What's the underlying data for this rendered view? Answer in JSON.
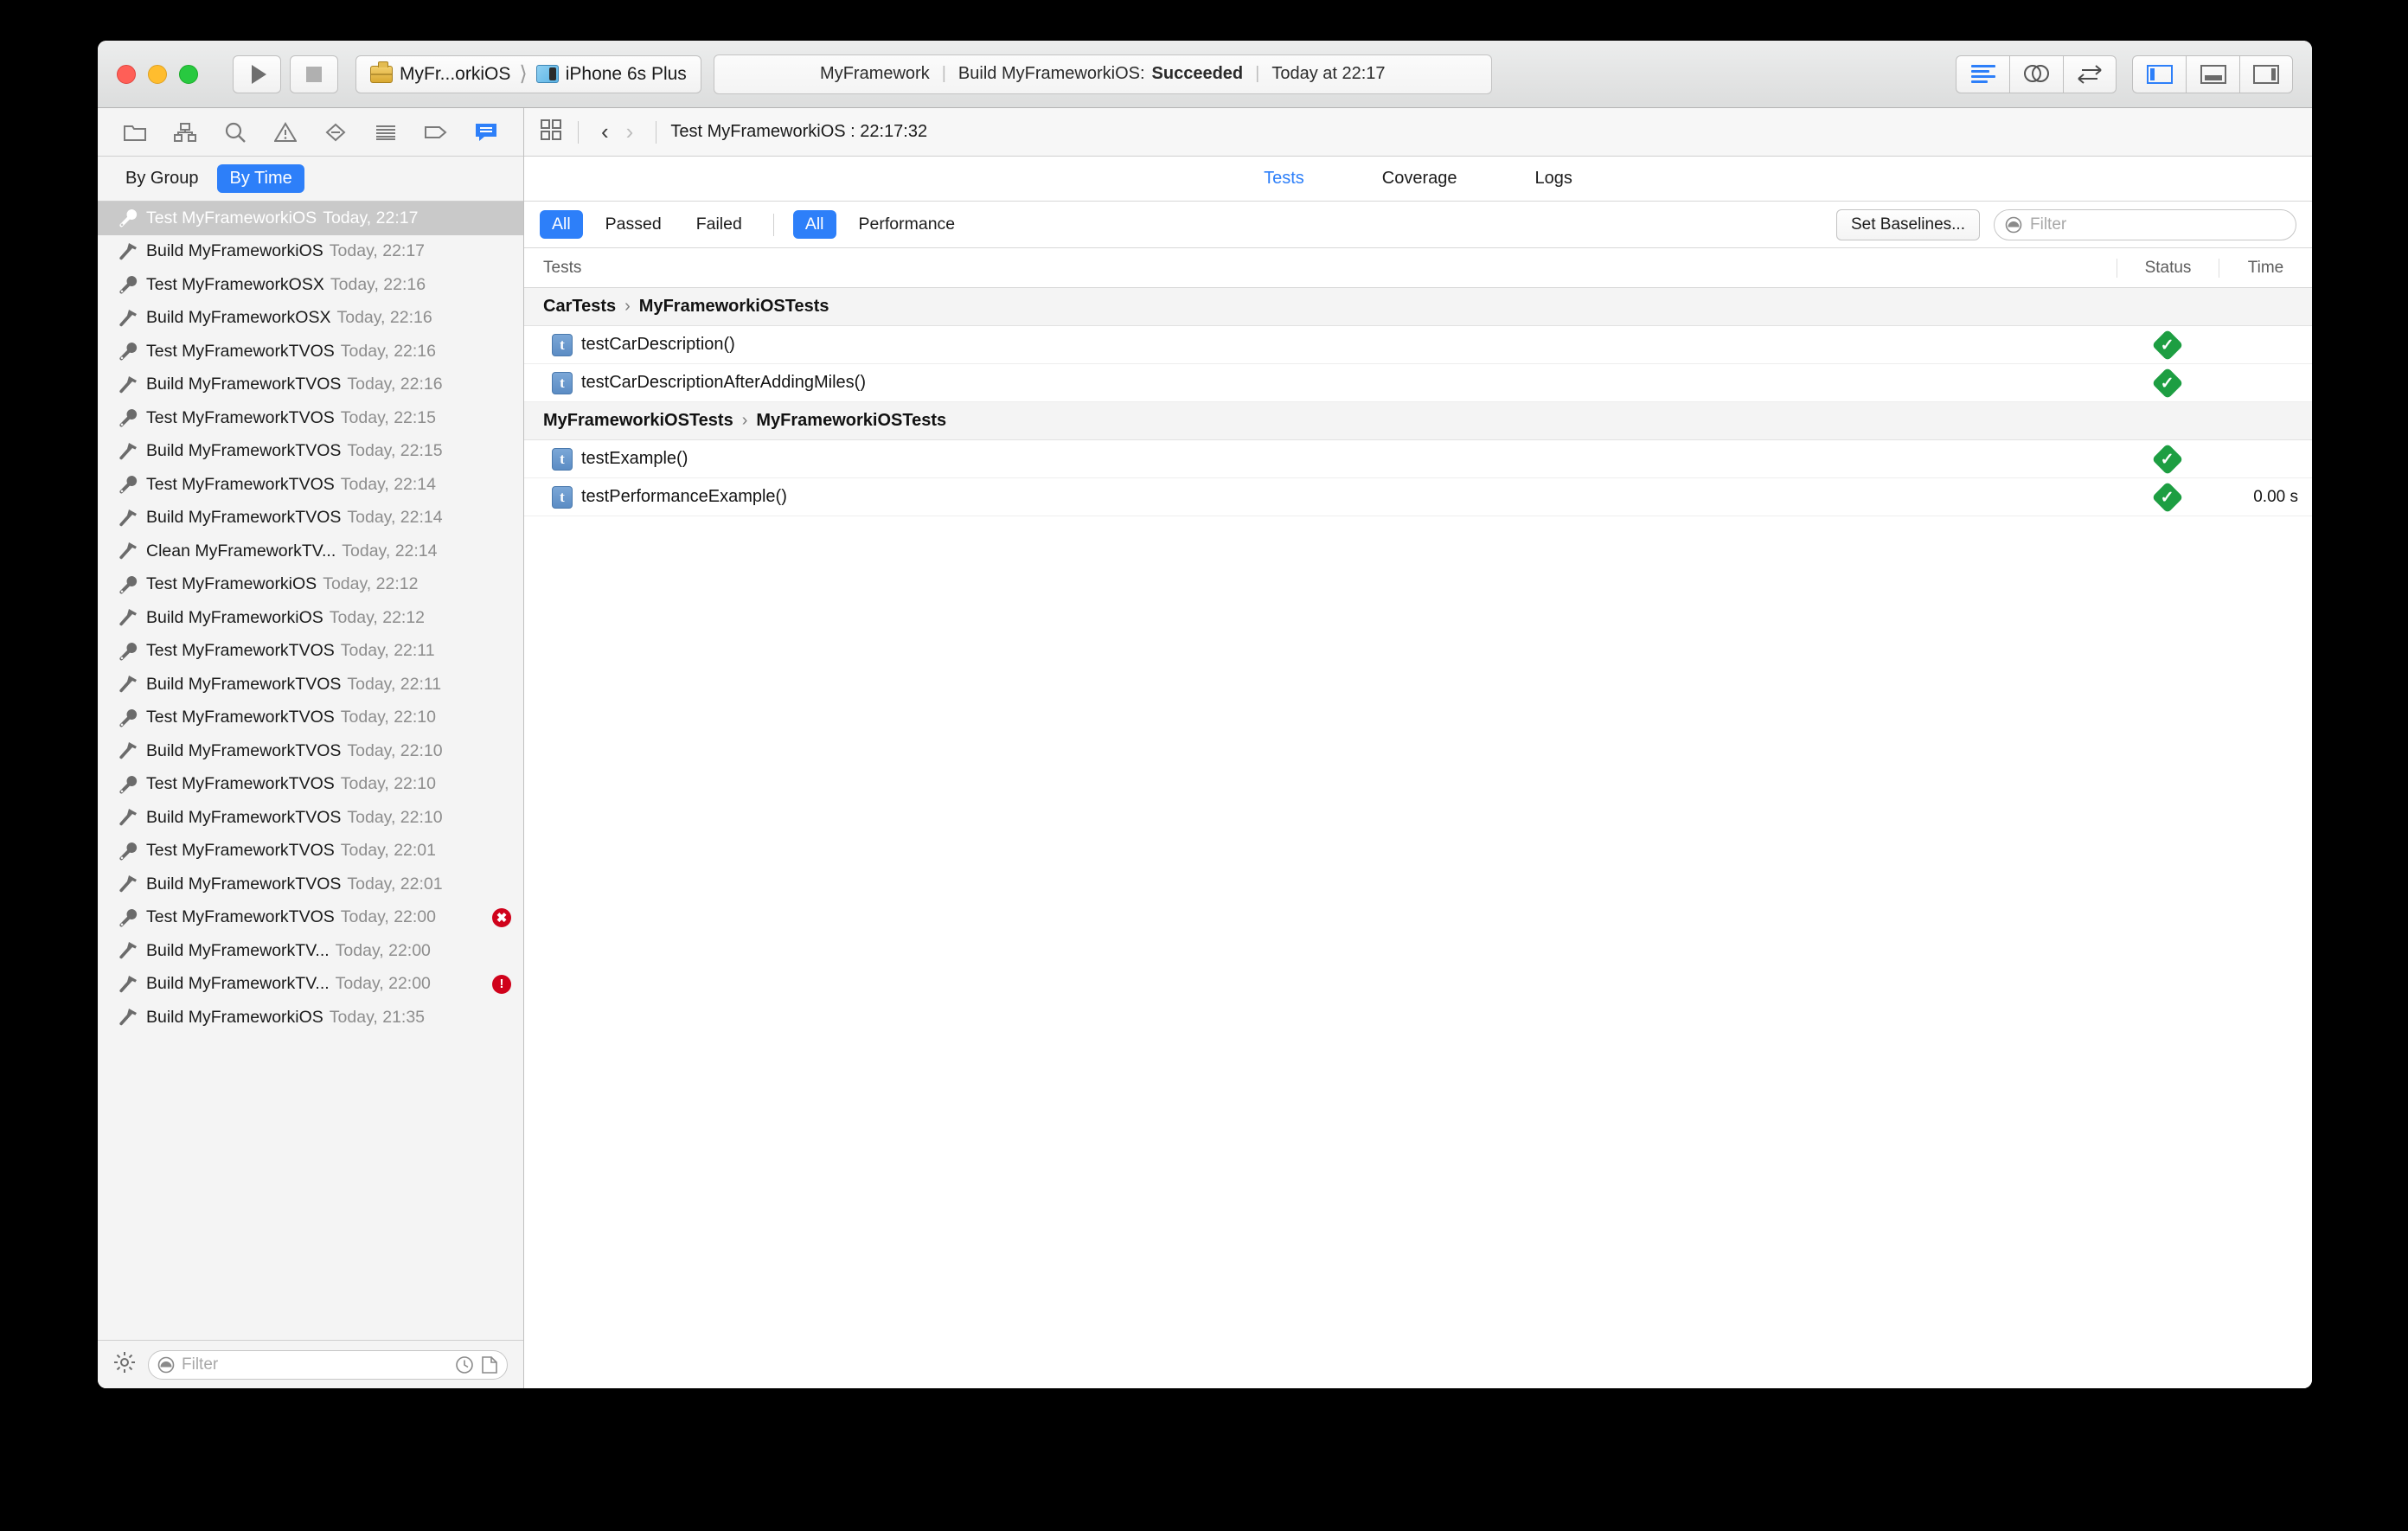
{
  "toolbar": {
    "run_label": "Run",
    "stop_label": "Stop",
    "scheme": "MyFr...orkiOS",
    "destination": "iPhone 6s Plus",
    "status": {
      "project": "MyFramework",
      "action": "Build MyFrameworkiOS:",
      "result": "Succeeded",
      "time": "Today at 22:17"
    },
    "editor_buttons": [
      "standard-editor",
      "assistant-editor",
      "version-editor"
    ],
    "view_buttons": [
      "navigator-toggle",
      "debug-area-toggle",
      "utilities-toggle"
    ]
  },
  "navigator": {
    "icons": [
      "folder-icon",
      "hierarchy-icon",
      "search-icon",
      "warning-icon",
      "breakpoint-icon",
      "report-list-icon",
      "tag-icon",
      "report-icon"
    ],
    "scope": {
      "by_group": "By Group",
      "by_time": "By Time",
      "selected": "By Time"
    },
    "rows": [
      {
        "icon": "wrench-icon",
        "label": "Test MyFrameworkiOS",
        "time": "Today, 22:17",
        "selected": true,
        "badge": ""
      },
      {
        "icon": "hammer-icon",
        "label": "Build MyFrameworkiOS",
        "time": "Today, 22:17",
        "selected": false,
        "badge": ""
      },
      {
        "icon": "wrench-icon",
        "label": "Test MyFrameworkOSX",
        "time": "Today, 22:16",
        "selected": false,
        "badge": ""
      },
      {
        "icon": "hammer-icon",
        "label": "Build MyFrameworkOSX",
        "time": "Today, 22:16",
        "selected": false,
        "badge": ""
      },
      {
        "icon": "wrench-icon",
        "label": "Test MyFrameworkTVOS",
        "time": "Today, 22:16",
        "selected": false,
        "badge": ""
      },
      {
        "icon": "hammer-icon",
        "label": "Build MyFrameworkTVOS",
        "time": "Today, 22:16",
        "selected": false,
        "badge": ""
      },
      {
        "icon": "wrench-icon",
        "label": "Test MyFrameworkTVOS",
        "time": "Today, 22:15",
        "selected": false,
        "badge": ""
      },
      {
        "icon": "hammer-icon",
        "label": "Build MyFrameworkTVOS",
        "time": "Today, 22:15",
        "selected": false,
        "badge": ""
      },
      {
        "icon": "wrench-icon",
        "label": "Test MyFrameworkTVOS",
        "time": "Today, 22:14",
        "selected": false,
        "badge": ""
      },
      {
        "icon": "hammer-icon",
        "label": "Build MyFrameworkTVOS",
        "time": "Today, 22:14",
        "selected": false,
        "badge": ""
      },
      {
        "icon": "hammer-icon",
        "label": "Clean MyFrameworkTV...",
        "time": "Today, 22:14",
        "selected": false,
        "badge": ""
      },
      {
        "icon": "wrench-icon",
        "label": "Test MyFrameworkiOS",
        "time": "Today, 22:12",
        "selected": false,
        "badge": ""
      },
      {
        "icon": "hammer-icon",
        "label": "Build MyFrameworkiOS",
        "time": "Today, 22:12",
        "selected": false,
        "badge": ""
      },
      {
        "icon": "wrench-icon",
        "label": "Test MyFrameworkTVOS",
        "time": "Today, 22:11",
        "selected": false,
        "badge": ""
      },
      {
        "icon": "hammer-icon",
        "label": "Build MyFrameworkTVOS",
        "time": "Today, 22:11",
        "selected": false,
        "badge": ""
      },
      {
        "icon": "wrench-icon",
        "label": "Test MyFrameworkTVOS",
        "time": "Today, 22:10",
        "selected": false,
        "badge": ""
      },
      {
        "icon": "hammer-icon",
        "label": "Build MyFrameworkTVOS",
        "time": "Today, 22:10",
        "selected": false,
        "badge": ""
      },
      {
        "icon": "wrench-icon",
        "label": "Test MyFrameworkTVOS",
        "time": "Today, 22:10",
        "selected": false,
        "badge": ""
      },
      {
        "icon": "hammer-icon",
        "label": "Build MyFrameworkTVOS",
        "time": "Today, 22:10",
        "selected": false,
        "badge": ""
      },
      {
        "icon": "wrench-icon",
        "label": "Test MyFrameworkTVOS",
        "time": "Today, 22:01",
        "selected": false,
        "badge": ""
      },
      {
        "icon": "hammer-icon",
        "label": "Build MyFrameworkTVOS",
        "time": "Today, 22:01",
        "selected": false,
        "badge": ""
      },
      {
        "icon": "wrench-icon",
        "label": "Test MyFrameworkTVOS",
        "time": "Today, 22:00",
        "selected": false,
        "badge": "error"
      },
      {
        "icon": "hammer-icon",
        "label": "Build MyFrameworkTV...",
        "time": "Today, 22:00",
        "selected": false,
        "badge": ""
      },
      {
        "icon": "hammer-icon",
        "label": "Build MyFrameworkTV...",
        "time": "Today, 22:00",
        "selected": false,
        "badge": "warning"
      },
      {
        "icon": "hammer-icon",
        "label": "Build MyFrameworkiOS",
        "time": "Today, 21:35",
        "selected": false,
        "badge": ""
      }
    ],
    "filter_placeholder": "Filter",
    "filter_value": ""
  },
  "editor": {
    "jumpbar": {
      "title": "Test MyFrameworkiOS : 22:17:32"
    },
    "tabs": [
      {
        "label": "Tests",
        "active": true
      },
      {
        "label": "Coverage",
        "active": false
      },
      {
        "label": "Logs",
        "active": false
      }
    ],
    "filters": {
      "result_group": [
        {
          "label": "All",
          "active": true
        },
        {
          "label": "Passed",
          "active": false
        },
        {
          "label": "Failed",
          "active": false
        }
      ],
      "kind_group": [
        {
          "label": "All",
          "active": true
        },
        {
          "label": "Performance",
          "active": false
        }
      ],
      "set_baselines": "Set Baselines...",
      "search_placeholder": "Filter",
      "search_value": ""
    },
    "table": {
      "columns": {
        "tests": "Tests",
        "status": "Status",
        "time": "Time"
      },
      "groups": [
        {
          "suite": "CarTests",
          "arrow": "›",
          "target": "MyFrameworkiOSTests",
          "tests": [
            {
              "name": "testCarDescription()",
              "status": "passed",
              "time": ""
            },
            {
              "name": "testCarDescriptionAfterAddingMiles()",
              "status": "passed",
              "time": ""
            }
          ]
        },
        {
          "suite": "MyFrameworkiOSTests",
          "arrow": "›",
          "target": "MyFrameworkiOSTests",
          "tests": [
            {
              "name": "testExample()",
              "status": "passed",
              "time": ""
            },
            {
              "name": "testPerformanceExample()",
              "status": "passed",
              "time": "0.00 s"
            }
          ]
        }
      ]
    }
  },
  "colors": {
    "accent": "#2d7ff9",
    "pass": "#1d9e42",
    "error": "#d0021b",
    "selection": "#c9c9c9"
  }
}
